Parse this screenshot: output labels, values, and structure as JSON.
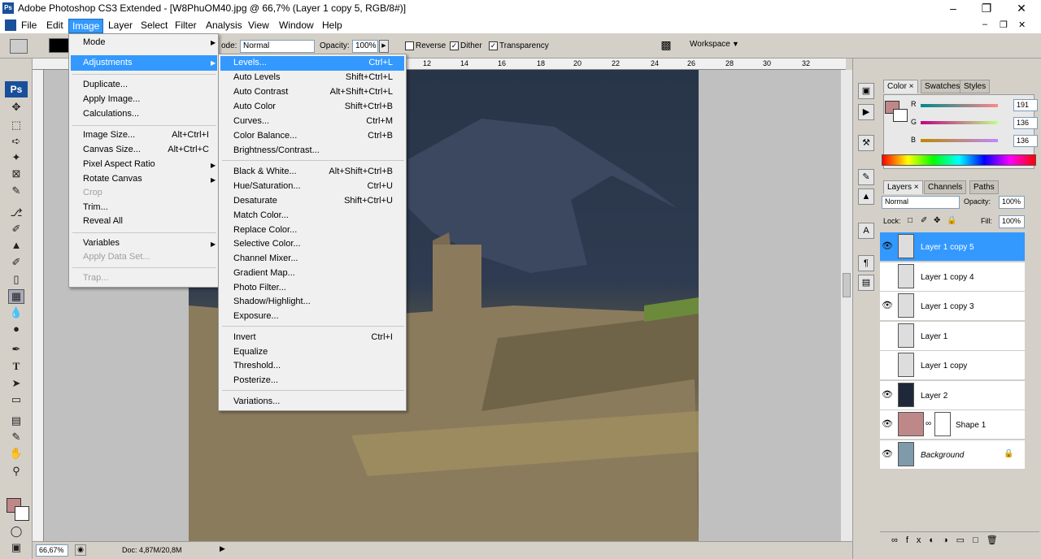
{
  "title_bar": {
    "app_icon": "Ps",
    "title": "Adobe Photoshop CS3 Extended - [W8PhuOM40.jpg @ 66,7% (Layer 1 copy 5, RGB/8#)]"
  },
  "menubar": [
    "File",
    "Edit",
    "Image",
    "Layer",
    "Select",
    "Filter",
    "Analysis",
    "View",
    "Window",
    "Help"
  ],
  "options": {
    "mode_label": "ode:",
    "mode_value": "Normal",
    "opacity_label": "Opacity:",
    "opacity_value": "100%",
    "reverse": "Reverse",
    "dither": "Dither",
    "transparency": "Transparency",
    "workspace": "Workspace"
  },
  "ruler_ticks": [
    "12",
    "14",
    "16",
    "18",
    "20",
    "22",
    "24",
    "26",
    "28",
    "30",
    "32"
  ],
  "status": {
    "zoom": "66,67%",
    "doc": "Doc: 4,87M/20,8M"
  },
  "image_menu": [
    {
      "label": "Mode",
      "arrow": true
    },
    {
      "label": "Adjustments",
      "arrow": true,
      "active": true
    },
    {
      "label": "Duplicate..."
    },
    {
      "label": "Apply Image..."
    },
    {
      "label": "Calculations..."
    },
    {
      "label": "Image Size...",
      "shortcut": "Alt+Ctrl+I"
    },
    {
      "label": "Canvas Size...",
      "shortcut": "Alt+Ctrl+C"
    },
    {
      "label": "Pixel Aspect Ratio",
      "arrow": true
    },
    {
      "label": "Rotate Canvas",
      "arrow": true
    },
    {
      "label": "Crop",
      "disabled": true
    },
    {
      "label": "Trim..."
    },
    {
      "label": "Reveal All"
    },
    {
      "label": "Variables",
      "arrow": true
    },
    {
      "label": "Apply Data Set...",
      "disabled": true
    },
    {
      "label": "Trap...",
      "disabled": true
    }
  ],
  "adjust_menu": [
    {
      "label": "Levels...",
      "shortcut": "Ctrl+L"
    },
    {
      "label": "Auto Levels",
      "shortcut": "Shift+Ctrl+L"
    },
    {
      "label": "Auto Contrast",
      "shortcut": "Alt+Shift+Ctrl+L"
    },
    {
      "label": "Auto Color",
      "shortcut": "Shift+Ctrl+B"
    },
    {
      "label": "Curves...",
      "shortcut": "Ctrl+M"
    },
    {
      "label": "Color Balance...",
      "shortcut": "Ctrl+B"
    },
    {
      "label": "Brightness/Contrast..."
    },
    {
      "label": "Black & White...",
      "shortcut": "Alt+Shift+Ctrl+B"
    },
    {
      "label": "Hue/Saturation...",
      "shortcut": "Ctrl+U"
    },
    {
      "label": "Desaturate",
      "shortcut": "Shift+Ctrl+U"
    },
    {
      "label": "Match Color..."
    },
    {
      "label": "Replace Color..."
    },
    {
      "label": "Selective Color..."
    },
    {
      "label": "Channel Mixer..."
    },
    {
      "label": "Gradient Map..."
    },
    {
      "label": "Photo Filter..."
    },
    {
      "label": "Shadow/Highlight..."
    },
    {
      "label": "Exposure..."
    },
    {
      "label": "Invert",
      "shortcut": "Ctrl+I"
    },
    {
      "label": "Equalize"
    },
    {
      "label": "Threshold..."
    },
    {
      "label": "Posterize..."
    },
    {
      "label": "Variations..."
    }
  ],
  "color_panel": {
    "tabs": [
      "Color",
      "Swatches",
      "Styles"
    ],
    "r": "191",
    "g": "136",
    "b": "136",
    "labels": [
      "R",
      "G",
      "B"
    ],
    "fg_color": "#bf8888"
  },
  "layers_panel": {
    "tabs": [
      "Layers",
      "Channels",
      "Paths"
    ],
    "blend": "Normal",
    "opacity_label": "Opacity:",
    "opacity": "100%",
    "lock_label": "Lock:",
    "fill_label": "Fill:",
    "fill": "100%",
    "layers": [
      {
        "name": "Layer 1 copy 5",
        "visible": true,
        "selected": true
      },
      {
        "name": "Layer 1 copy 4",
        "visible": false
      },
      {
        "name": "Layer 1 copy 3",
        "visible": true
      },
      {
        "name": "Layer 1",
        "visible": false
      },
      {
        "name": "Layer 1 copy",
        "visible": false
      },
      {
        "name": "Layer 2",
        "visible": true
      },
      {
        "name": "Shape 1",
        "visible": true
      },
      {
        "name": "Background",
        "visible": true
      }
    ]
  }
}
